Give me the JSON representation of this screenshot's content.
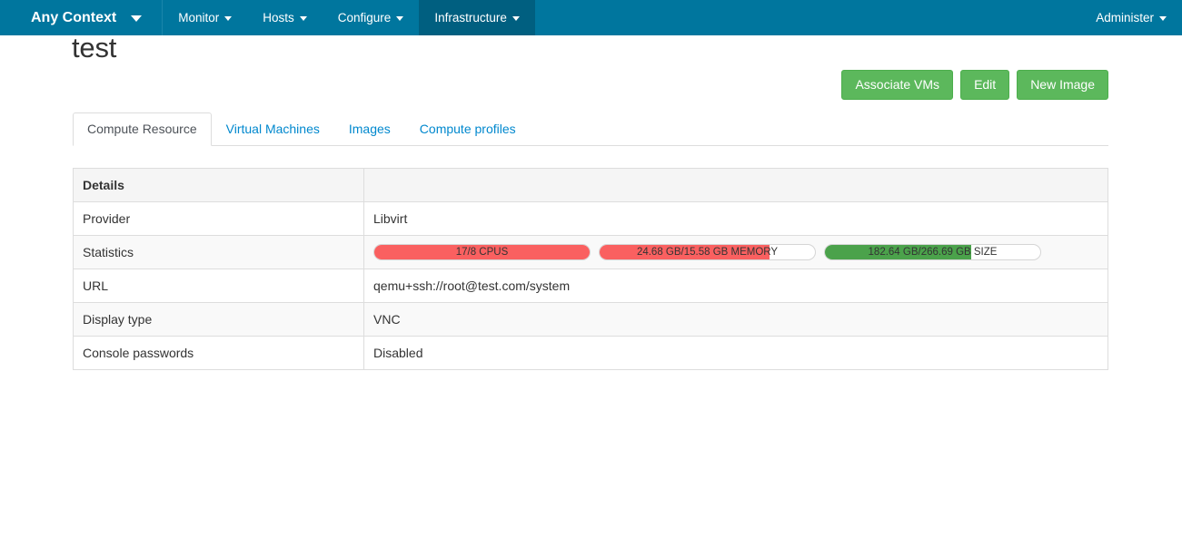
{
  "navbar": {
    "context_label": "Any Context",
    "context_caret": "caret-down-icon",
    "items": [
      {
        "label": "Monitor",
        "active": false
      },
      {
        "label": "Hosts",
        "active": false
      },
      {
        "label": "Configure",
        "active": false
      },
      {
        "label": "Infrastructure",
        "active": true
      }
    ],
    "right_items": [
      {
        "label": "Administer"
      }
    ],
    "background_color": "#00769e",
    "active_background_color": "#005f80"
  },
  "page": {
    "title": "test"
  },
  "actions": {
    "buttons": [
      {
        "label": "Associate VMs",
        "name": "associate-vms-button"
      },
      {
        "label": "Edit",
        "name": "edit-button"
      },
      {
        "label": "New Image",
        "name": "new-image-button"
      }
    ],
    "button_color": "#5cb85c"
  },
  "tabs": [
    {
      "label": "Compute Resource",
      "active": true
    },
    {
      "label": "Virtual Machines",
      "active": false
    },
    {
      "label": "Images",
      "active": false
    },
    {
      "label": "Compute profiles",
      "active": false
    }
  ],
  "details_table": {
    "header": {
      "label": "Details",
      "value": ""
    },
    "rows": [
      {
        "label": "Provider",
        "value": "Libvirt",
        "type": "text"
      },
      {
        "label": "Statistics",
        "value": "",
        "type": "stats"
      },
      {
        "label": "URL",
        "value": "qemu+ssh://root@test.com/system",
        "type": "text"
      },
      {
        "label": "Display type",
        "value": "VNC",
        "type": "text"
      },
      {
        "label": "Console passwords",
        "value": "Disabled",
        "type": "text"
      }
    ]
  },
  "statistics": {
    "bars": [
      {
        "name": "cpus-progress-bar",
        "label": "17/8 CPUS",
        "percent": 100,
        "color": "#fa6060"
      },
      {
        "name": "memory-progress-bar",
        "label": "24.68 GB/15.58 GB MEMORY",
        "percent": 79,
        "color": "#fa6060"
      },
      {
        "name": "size-progress-bar",
        "label": "182.64 GB/266.69 GB SIZE",
        "percent": 68,
        "color": "#4ba24b"
      }
    ]
  }
}
